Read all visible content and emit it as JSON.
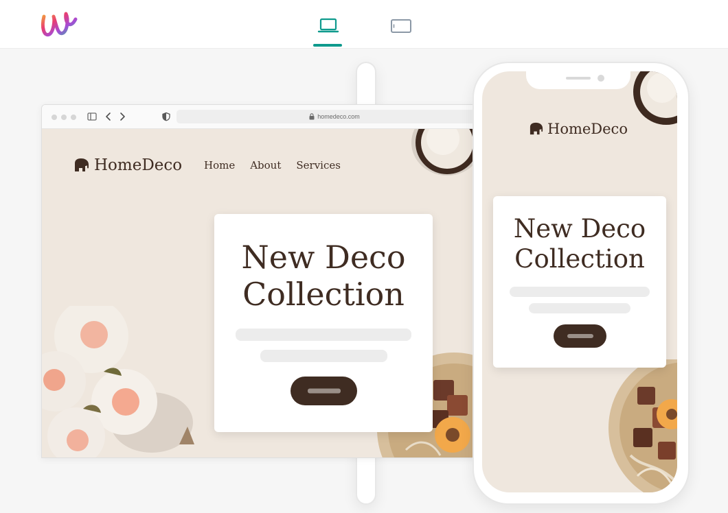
{
  "app": {
    "logo_icon": "brand-w-logo-icon"
  },
  "toolbar": {
    "devices": [
      {
        "name": "desktop-view",
        "icon": "laptop-icon",
        "active": true
      },
      {
        "name": "mobile-view",
        "icon": "phone-icon",
        "active": false
      },
      {
        "name": "tablet-view",
        "icon": "tablet-icon",
        "active": false
      }
    ],
    "accent_color": "#0e9a8d"
  },
  "browser": {
    "url": "homedeco.com",
    "site": {
      "brand": "HomeDeco",
      "nav": [
        "Home",
        "About",
        "Services"
      ],
      "hero_line1": "New Deco",
      "hero_line2": "Collection"
    }
  },
  "phone": {
    "site": {
      "brand": "HomeDeco",
      "hero_line1": "New Deco",
      "hero_line2": "Collection"
    }
  },
  "colors": {
    "brand_dark": "#3f2c22",
    "site_background": "#efe7de",
    "placeholder": "#ececec"
  }
}
